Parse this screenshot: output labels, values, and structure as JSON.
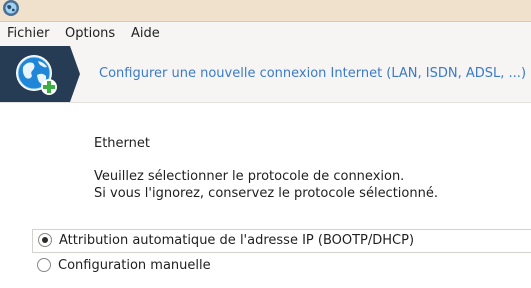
{
  "window": {
    "app_icon": "globe-app-icon"
  },
  "menubar": {
    "items": [
      {
        "label": "Fichier"
      },
      {
        "label": "Options"
      },
      {
        "label": "Aide"
      }
    ]
  },
  "banner": {
    "icon": "globe-add-icon",
    "title": "Configurer une nouvelle connexion Internet (LAN, ISDN, ADSL, ...)",
    "title_color": "#3a7bc8",
    "panel_color": "#263c55"
  },
  "content": {
    "connection_type": "Ethernet",
    "instruction_line1": "Veuillez sélectionner le protocole de connexion.",
    "instruction_line2": "Si vous l'ignorez, conservez le protocole sélectionné."
  },
  "protocol_options": [
    {
      "label": "Attribution automatique de l'adresse IP (BOOTP/DHCP)",
      "selected": true
    },
    {
      "label": "Configuration manuelle",
      "selected": false
    }
  ]
}
